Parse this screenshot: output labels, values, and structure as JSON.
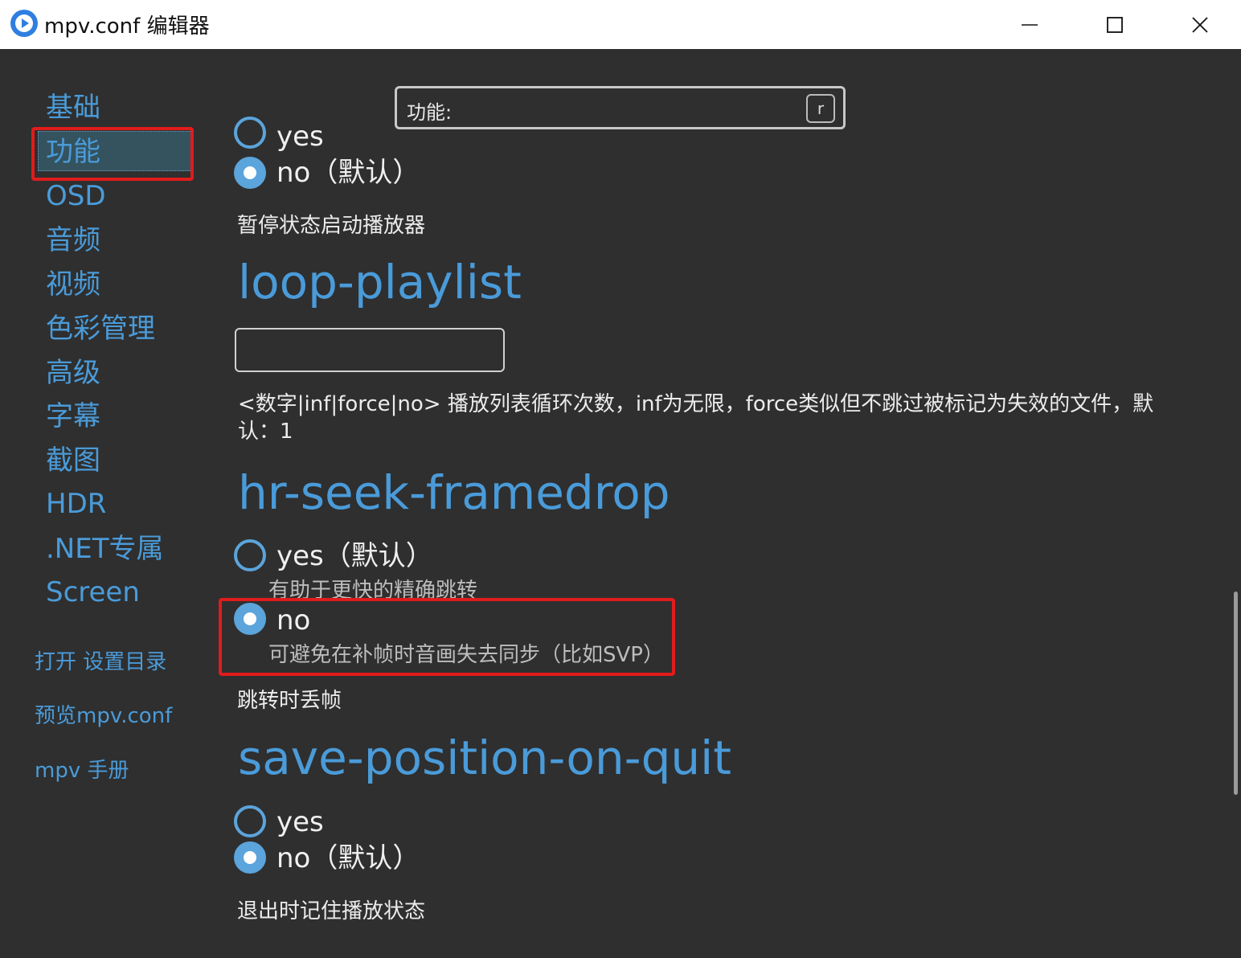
{
  "window": {
    "title": "mpv.conf 编辑器"
  },
  "search": {
    "label": "功能:",
    "shortcut": "r"
  },
  "sidebar": {
    "items": [
      {
        "label": "基础"
      },
      {
        "label": "功能",
        "selected": true
      },
      {
        "label": "OSD"
      },
      {
        "label": "音频"
      },
      {
        "label": "视频"
      },
      {
        "label": "色彩管理"
      },
      {
        "label": "高级"
      },
      {
        "label": "字幕"
      },
      {
        "label": "截图"
      },
      {
        "label": "HDR"
      },
      {
        "label": ".NET专属"
      },
      {
        "label": "Screen"
      }
    ],
    "links": {
      "open_settings": "打开 设置目录",
      "preview": "预览mpv.conf",
      "manual": "mpv 手册"
    }
  },
  "content": {
    "prev_option": {
      "yes_label": "yes",
      "no_label": "no（默认）",
      "description": "暂停状态启动播放器"
    },
    "loop_playlist": {
      "title": "loop-playlist",
      "value": "",
      "description": "<数字|inf|force|no> 播放列表循环次数，inf为无限，force类似但不跳过被标记为失效的文件，默认：1"
    },
    "hr_seek_framedrop": {
      "title": "hr-seek-framedrop",
      "yes_label": "yes（默认）",
      "yes_sub": "有助于更快的精确跳转",
      "no_label": "no",
      "no_sub": "可避免在补帧时音画失去同步（比如SVP）",
      "description": "跳转时丢帧"
    },
    "save_position_on_quit": {
      "title": "save-position-on-quit",
      "yes_label": "yes",
      "no_label": "no（默认）",
      "description": "退出时记住播放状态"
    }
  },
  "colors": {
    "accent": "#4a9bd9",
    "background": "#2f2f2f",
    "highlight": "#e01c1c"
  }
}
